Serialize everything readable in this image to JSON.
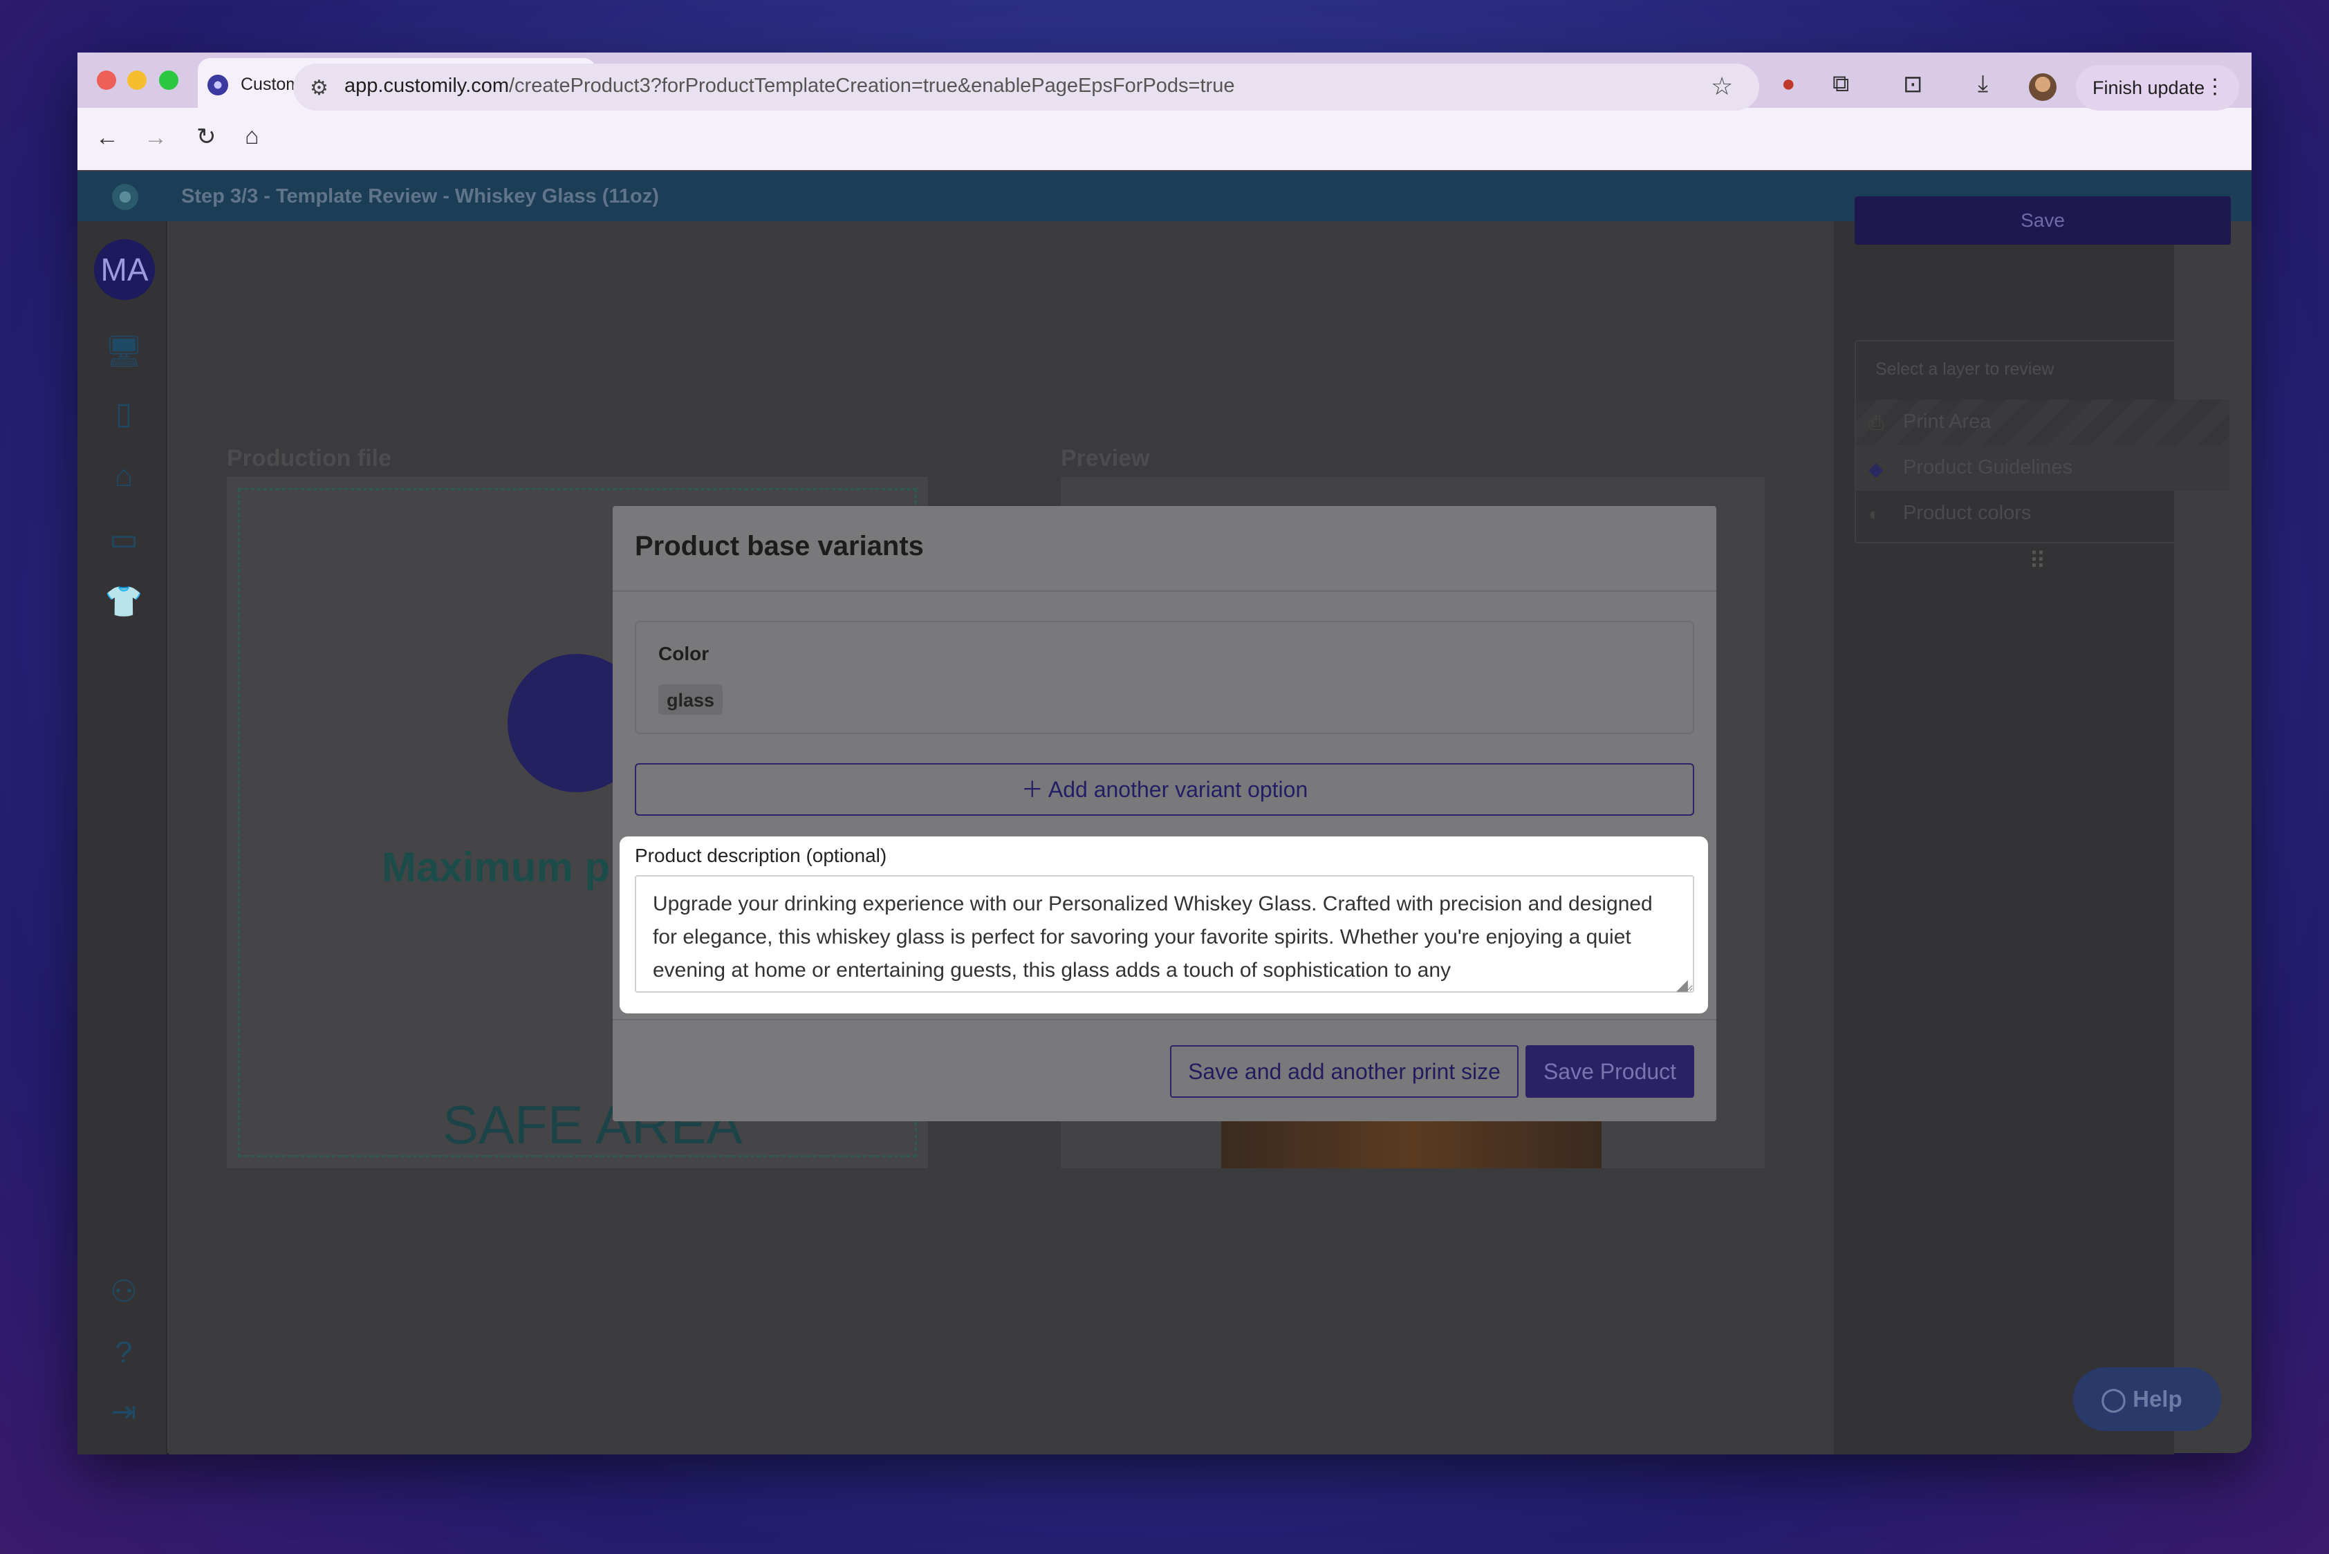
{
  "browser": {
    "tab_title": "Customily",
    "url_host": "app.customily.com",
    "url_path": "/createProduct3?forProductTemplateCreation=true&enablePageEpsForPods=true",
    "finish_update_label": "Finish update"
  },
  "app": {
    "step_title": "Step 3/3 - Template Review - Whiskey Glass (11oz)",
    "avatar_initials": "MA",
    "production_label": "Production file",
    "preview_label": "Preview",
    "max_text": "Maximum pr",
    "safe_area": "SAFE AREA",
    "save_label": "Save",
    "layers_heading": "Select a layer to review",
    "layers": [
      {
        "label": "Print Area",
        "icon": "printer-icon"
      },
      {
        "label": "Product Guidelines",
        "icon": "tag-icon"
      },
      {
        "label": "Product colors",
        "icon": "palette-icon"
      }
    ],
    "help_label": "Help"
  },
  "modal": {
    "title": "Product base variants",
    "variant_option_label": "Color",
    "variant_values": [
      "glass"
    ],
    "add_variant_label": "Add another variant option",
    "description_label": "Product description (optional)",
    "description_value": "Upgrade your drinking experience with our Personalized Whiskey Glass. Crafted with precision and designed for elegance, this whiskey glass is perfect for savoring your favorite spirits. Whether you're enjoying a quiet evening at home or entertaining guests, this glass adds a touch of sophistication to any",
    "save_add_label": "Save and add another print size",
    "save_product_label": "Save Product"
  },
  "colors": {
    "accent": "#2b2266",
    "modal_overlay": "#79797b"
  }
}
